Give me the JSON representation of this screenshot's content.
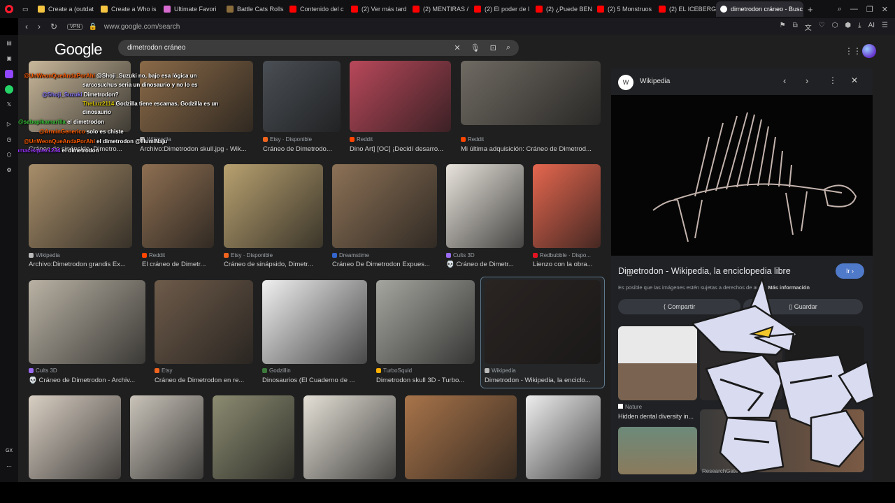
{
  "tabs": [
    {
      "label": "Create a (outdat",
      "color": "#f5c542"
    },
    {
      "label": "Create a Who is",
      "color": "#f5c542"
    },
    {
      "label": "Ultimate Favori",
      "color": "#d76bd0"
    },
    {
      "label": "Battle Cats Rolls",
      "color": "#8a6d3b"
    },
    {
      "label": "Contenido del c",
      "color": "#ff0000"
    },
    {
      "label": "(2) Ver más tard",
      "color": "#ff0000"
    },
    {
      "label": "(2) MENTIRAS /",
      "color": "#ff0000"
    },
    {
      "label": "(2) El poder de l",
      "color": "#ff0000"
    },
    {
      "label": "(2) ¿Puede BEN",
      "color": "#ff0000"
    },
    {
      "label": "(2) 5 Monstruos",
      "color": "#ff0000"
    },
    {
      "label": "(2) EL ICEBERG",
      "color": "#ff0000"
    },
    {
      "label": "dimetrodon cráneo - Busc",
      "color": "#ffffff"
    }
  ],
  "new_tab": "+",
  "address": {
    "vpn": "VPN",
    "url": "www.google.com/search",
    "ai": "AI"
  },
  "logo": "Google",
  "search_query": "dimetrodon cráneo",
  "results": [
    {
      "source": "",
      "caption": "Cráneo de sinápsido, Dimetro...",
      "color": "#c8b79a",
      "sc": "#e6744a"
    },
    {
      "source": "Wikipedia",
      "caption": "Archivo:Dimetrodon skull.jpg - Wik...",
      "color": "#8a6a48",
      "sc": "#bbbbbb"
    },
    {
      "source": "Etsy · Disponible",
      "caption": "Cráneo de Dimetrodo...",
      "color": "#4a4f55",
      "sc": "#f1641e"
    },
    {
      "source": "Reddit",
      "caption": "Dino Art] [OC] ¡Decidí desarro...",
      "color": "#b8485a",
      "sc": "#ff4500"
    },
    {
      "source": "Reddit",
      "caption": "Mi última adquisición: Cráneo de Dimetrod...",
      "color": "#6f6a62",
      "sc": "#ff4500"
    },
    {
      "source": "Wikipedia",
      "caption": "Archivo:Dimetrodon grandis Ex...",
      "color": "#a88e6a",
      "sc": "#bbbbbb"
    },
    {
      "source": "Reddit",
      "caption": "El cráneo de Dimetr...",
      "color": "#8e6f52",
      "sc": "#ff4500"
    },
    {
      "source": "Etsy · Disponible",
      "caption": "Cráneo de sinápsido, Dimetr...",
      "color": "#b8a170",
      "sc": "#f1641e"
    },
    {
      "source": "Dreamstime",
      "caption": "Cráneo De Dimetrodon Expues...",
      "color": "#8c7156",
      "sc": "#3366cc"
    },
    {
      "source": "Cults 3D",
      "caption": "💀 Cráneo de Dimetr...",
      "color": "#e8e4dc",
      "sc": "#9b6cf2"
    },
    {
      "source": "Redbubble · Dispo...",
      "caption": "Lienzo con la obra...",
      "color": "#e5674f",
      "sc": "#e41321"
    },
    {
      "source": "Cults 3D",
      "caption": "💀 Cráneo de Dimetrodon - Archiv...",
      "color": "#b9b2a4",
      "sc": "#9b6cf2"
    },
    {
      "source": "Etsy",
      "caption": "Cráneo de Dimetrodon en re...",
      "color": "#6e5b4a",
      "sc": "#f1641e"
    },
    {
      "source": "Godzillin",
      "caption": "Dinosaurios (El Cuaderno de ...",
      "color": "#f0f0f0",
      "sc": "#3b7a3b"
    },
    {
      "source": "TurboSquid",
      "caption": "Dimetrodon skull 3D - Turbo...",
      "color": "#a6a6a0",
      "sc": "#ffb000"
    },
    {
      "source": "Wikipedia",
      "caption": "Dimetrodon - Wikipedia, la enciclo...",
      "color": "#2a2422",
      "sc": "#bbbbbb"
    },
    {
      "source": "",
      "caption": "",
      "color": "#d9cfc3",
      "sc": "#999999"
    },
    {
      "source": "",
      "caption": "",
      "color": "#c9c3b9",
      "sc": "#999999"
    },
    {
      "source": "",
      "caption": "",
      "color": "#8c8c72",
      "sc": "#999999"
    },
    {
      "source": "",
      "caption": "",
      "color": "#e4e0d6",
      "sc": "#999999"
    },
    {
      "source": "",
      "caption": "",
      "color": "#a8744a",
      "sc": "#999999"
    },
    {
      "source": "",
      "caption": "",
      "color": "#eeeeee",
      "sc": "#999999"
    }
  ],
  "panel": {
    "site": "Wikipedia",
    "site_letter": "W",
    "title": "Dimetrodon - Wikipedia, la enciclopedia libre",
    "go_button": "Ir",
    "notice": "Es posible que las imágenes estén sujetas a derechos de autor.",
    "more_info": "Más información",
    "share": "Compartir",
    "save": "Guardar",
    "related_source": "Nature",
    "related_caption": "Hidden dental diversity in...",
    "related_source2": "ResearchGate"
  },
  "chat": [
    {
      "user": "@UnWeonQueAndaPorAhí",
      "msg": "@Shoji_Suzuki no, bajo esa lógica un",
      "color": "#ff5a00"
    },
    {
      "user": "",
      "msg": "sarcosuchus seria un dinosaurio y no lo es",
      "color": "#ffffff"
    },
    {
      "user": "@Shoji_Suzuki",
      "msg": "Dimetrodon?",
      "color": "#8a7bff"
    },
    {
      "user": "TheLuz2114",
      "msg": "Godzilla tiene escamas, Godzilla es un",
      "color": "#d7c400"
    },
    {
      "user": "",
      "msg": "dinosaurio",
      "color": "#ffffff"
    },
    {
      "user": "@sabapikamarilla",
      "msg": "el dimetrodon",
      "color": "#38c338"
    },
    {
      "user": "@ArminGenerico",
      "msg": "solo es chiste",
      "color": "#ff5a00"
    },
    {
      "user": "@UnWeonQueAndaPorAhí",
      "msg": "el dimetrodon @IllumiNaju",
      "color": "#ff5a00"
    },
    {
      "user": "@adamacisquez1234",
      "msg": "el dimetrodon",
      "color": "#9933ff"
    }
  ],
  "sidebar_label": "GX"
}
